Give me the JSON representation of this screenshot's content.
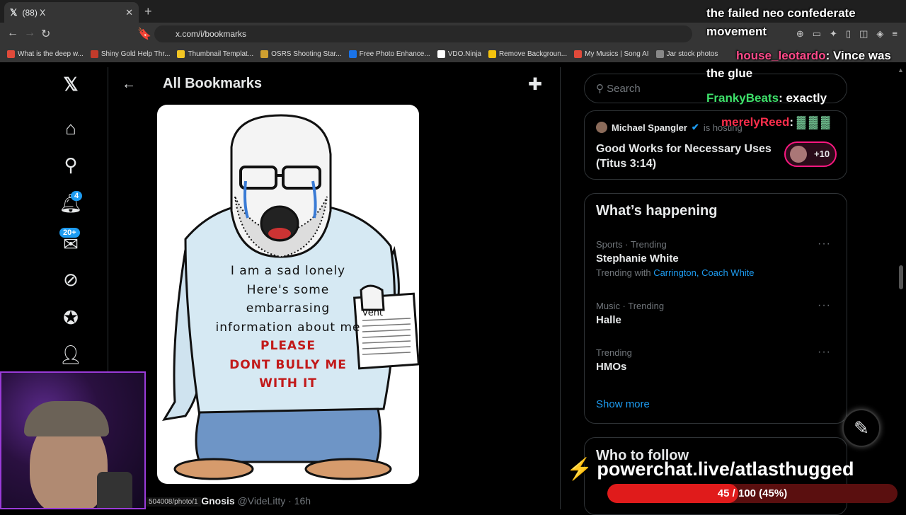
{
  "browser": {
    "tab_title": "(88) X",
    "url": "x.com/i/bookmarks",
    "bookmarks": [
      {
        "label": "What is the deep w...",
        "color": "#e04a3a"
      },
      {
        "label": "Shiny Gold Help Thr...",
        "color": "#c23b2b"
      },
      {
        "label": "Thumbnail Templat...",
        "color": "#f3c623"
      },
      {
        "label": "OSRS Shooting Star...",
        "color": "#d0a030"
      },
      {
        "label": "Free Photo Enhance...",
        "color": "#1a73e8"
      },
      {
        "label": "VDO.Ninja",
        "color": "#ffffff"
      },
      {
        "label": "Remove Backgroun...",
        "color": "#f4c20d"
      },
      {
        "label": "My Musics | Song AI",
        "color": "#e04a3a"
      },
      {
        "label": "Jar stock photos",
        "color": "#888888"
      }
    ]
  },
  "nav": {
    "notifications_badge": "4",
    "messages_badge": "20+"
  },
  "main": {
    "title": "All Bookmarks",
    "media": {
      "line1": "I am a sad lonely",
      "line2": "",
      "line3": "Here's some",
      "line4": "embarrasing",
      "line5": "information about me",
      "line6": "PLEASE",
      "line7": "DONT BULLY ME",
      "line8": "WITH IT",
      "paper_label": "vent"
    },
    "next_post": {
      "name": "Not Sure Gnosis",
      "handle": "@VideLitty · 16h"
    },
    "status_url": "504008/photo/1"
  },
  "sidebar": {
    "search_placeholder": "Search",
    "space": {
      "host": "Michael Spangler",
      "hosting": "is hosting",
      "title": "Good Works for Necessary Uses (Titus 3:14)",
      "listeners": "+10"
    },
    "happening_title": "What’s happening",
    "trends": [
      {
        "meta": "Sports · Trending",
        "name": "Stephanie White",
        "with_label": "Trending with",
        "with_links": "Carrington, Coach White"
      },
      {
        "meta": "Music · Trending",
        "name": "Halle"
      },
      {
        "meta": "Trending",
        "name": "HMOs"
      }
    ],
    "show_more": "Show more",
    "who_to_follow": "Who to follow"
  },
  "overlay": {
    "chat": [
      {
        "user": "",
        "text": "the failed neo confederate"
      },
      {
        "user": "",
        "text": "movement"
      },
      {
        "user": "house_leotardo",
        "text": ": Vince was"
      },
      {
        "user": "",
        "text": "the glue"
      },
      {
        "user": "FrankyBeats",
        "text": ": exactly"
      },
      {
        "user": "merelyReed",
        "text": ":"
      }
    ],
    "brand": "powerchat.live/atlasthugged",
    "progress": {
      "label": "45 / 100 (45%)",
      "fraction": 0.45
    }
  }
}
